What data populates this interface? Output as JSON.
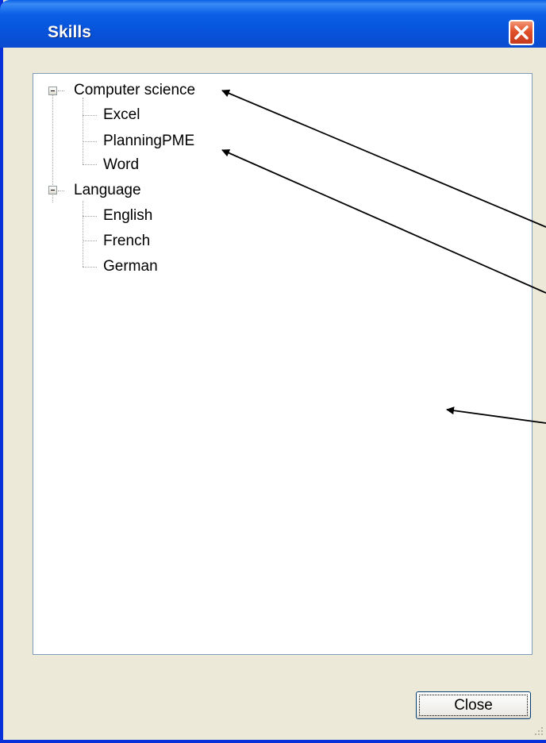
{
  "window": {
    "title": "Skills",
    "close_icon": "close-icon"
  },
  "tree": {
    "groups": [
      {
        "label": "Computer science",
        "expanded": true,
        "children": [
          "Excel",
          "PlanningPME",
          "Word"
        ]
      },
      {
        "label": "Language",
        "expanded": true,
        "children": [
          "English",
          "French",
          "German"
        ]
      }
    ]
  },
  "footer": {
    "close_label": "Close"
  },
  "colors": {
    "titlebar": "#0a5fe6",
    "window_body": "#ece9d8",
    "close_x": "#e0502a",
    "panel_border": "#7f9db9"
  },
  "annotations": {
    "arrow_count": 3
  }
}
